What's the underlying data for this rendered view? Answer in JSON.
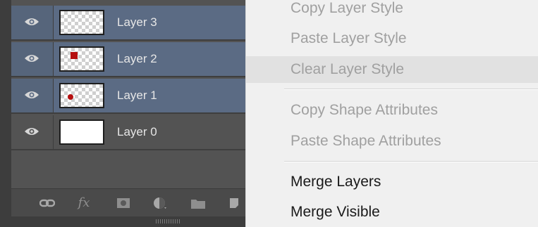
{
  "layers_panel": {
    "layers": [
      {
        "name": "Layer 3",
        "selected": true,
        "thumbnail": "transparent-checker"
      },
      {
        "name": "Layer 2",
        "selected": true,
        "thumbnail": "red-square-on-transparent"
      },
      {
        "name": "Layer 1",
        "selected": true,
        "thumbnail": "red-dot-on-transparent"
      },
      {
        "name": "Layer 0",
        "selected": false,
        "thumbnail": "white-fill"
      }
    ],
    "toolbar_icons": [
      "link-layers-icon",
      "fx-icon",
      "layer-mask-icon",
      "adjustment-layer-icon",
      "folder-icon",
      "new-layer-icon"
    ],
    "toolbar_fx_label": "fx"
  },
  "context_menu": {
    "items": [
      {
        "label": "Copy Layer Style",
        "enabled": false
      },
      {
        "label": "Paste Layer Style",
        "enabled": false
      },
      {
        "label": "Clear Layer Style",
        "enabled": false,
        "highlighted": true
      },
      {
        "label": "Copy Shape Attributes",
        "enabled": false
      },
      {
        "label": "Paste Shape Attributes",
        "enabled": false
      },
      {
        "label": "Merge Layers",
        "enabled": true
      },
      {
        "label": "Merge Visible",
        "enabled": true
      }
    ]
  },
  "colors": {
    "panel_bg": "#535353",
    "selected_layer": "#5b6b84",
    "menu_bg": "#f0f0f0",
    "shape_red": "#b50f0f"
  }
}
